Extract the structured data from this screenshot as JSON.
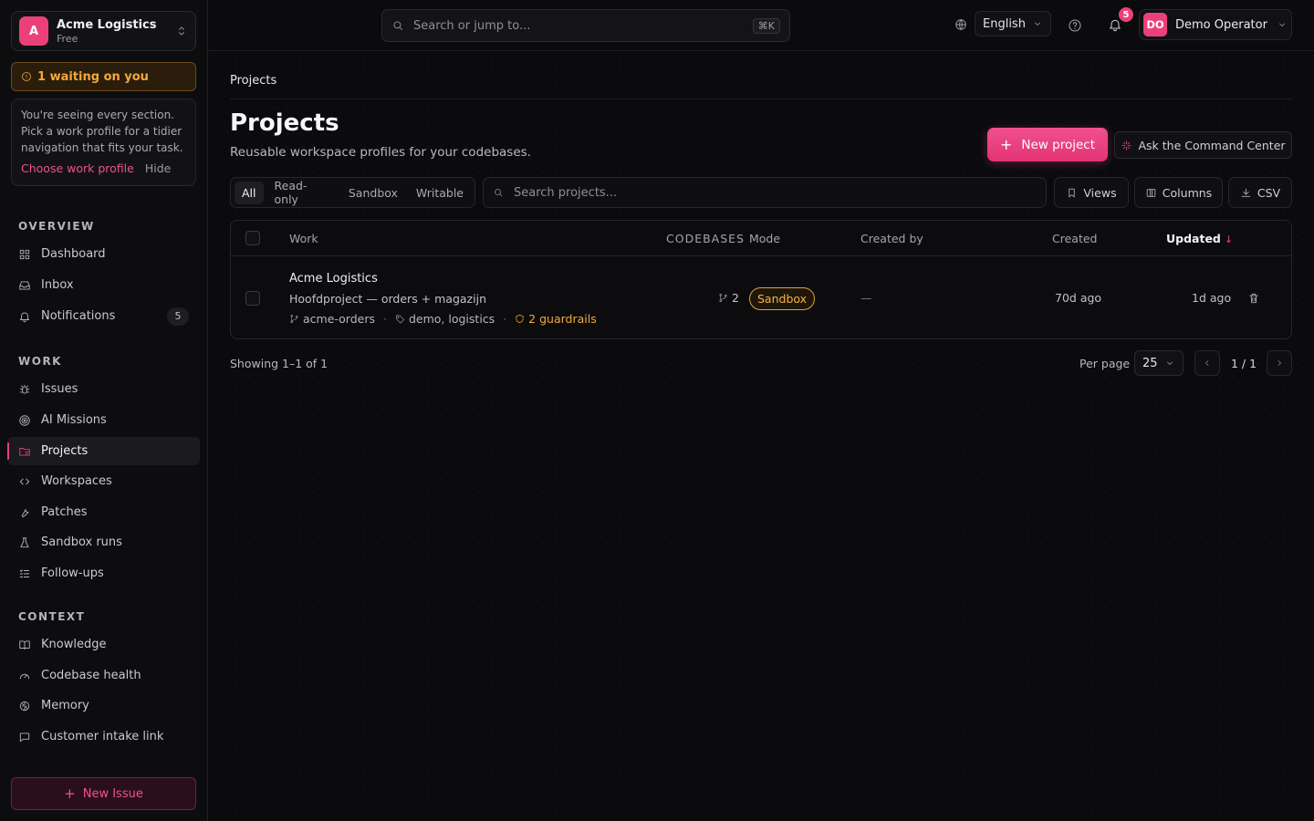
{
  "org": {
    "initial": "A",
    "name": "Acme Logistics",
    "plan": "Free"
  },
  "waiting": {
    "label": "1 waiting on you"
  },
  "profile_card": {
    "text": "You're seeing every section. Pick a work profile for a tidier navigation that fits your task.",
    "choose_label": "Choose work profile",
    "hide_label": "Hide"
  },
  "sidebar": {
    "overview_title": "OVERVIEW",
    "overview": [
      {
        "label": "Dashboard",
        "icon": "grid-icon"
      },
      {
        "label": "Inbox",
        "icon": "inbox-icon"
      },
      {
        "label": "Notifications",
        "icon": "bell-icon",
        "badge": "5"
      }
    ],
    "work_title": "WORK",
    "work": [
      {
        "label": "Issues",
        "icon": "bug-icon"
      },
      {
        "label": "AI Missions",
        "icon": "target-icon"
      },
      {
        "label": "Projects",
        "icon": "folder-icon",
        "active": true
      },
      {
        "label": "Workspaces",
        "icon": "code-icon"
      },
      {
        "label": "Patches",
        "icon": "wrench-icon"
      },
      {
        "label": "Sandbox runs",
        "icon": "flask-icon"
      },
      {
        "label": "Follow-ups",
        "icon": "list-check-icon"
      }
    ],
    "context_title": "CONTEXT",
    "context": [
      {
        "label": "Knowledge",
        "icon": "book-icon"
      },
      {
        "label": "Codebase health",
        "icon": "gauge-icon"
      },
      {
        "label": "Memory",
        "icon": "brain-icon"
      },
      {
        "label": "Customer intake link",
        "icon": "message-icon"
      }
    ],
    "new_issue_label": "New Issue"
  },
  "topbar": {
    "search_placeholder": "Search or jump to...",
    "search_shortcut": "⌘K",
    "language": "English",
    "notification_count": "5",
    "user_initials": "DO",
    "user_name": "Demo Operator"
  },
  "main": {
    "breadcrumb": "Projects",
    "title": "Projects",
    "subtitle": "Reusable workspace profiles for your codebases.",
    "new_project_label": "New project",
    "ask_label": "Ask the Command Center",
    "filter_tabs": [
      "All",
      "Read-only",
      "Sandbox",
      "Writable"
    ],
    "active_filter": "All",
    "table_search_placeholder": "Search projects...",
    "views_label": "Views",
    "columns_label": "Columns",
    "csv_label": "CSV",
    "columns": {
      "work": "Work",
      "codebases": "CODEBASES",
      "mode": "Mode",
      "created_by": "Created by",
      "created": "Created",
      "updated": "Updated",
      "sort_arrow": "↓"
    },
    "rows": [
      {
        "name": "Acme Logistics",
        "description": "Hoofdproject — orders + magazijn",
        "repo": "acme-orders",
        "tags": "demo, logistics",
        "guardrails": "2 guardrails",
        "codebases": "2",
        "mode": "Sandbox",
        "created_by": "—",
        "created": "70d ago",
        "updated": "1d ago"
      }
    ],
    "showing": "Showing 1–1 of 1",
    "per_page_label": "Per page",
    "per_page_value": "25",
    "page_indicator": "1 / 1"
  },
  "colors": {
    "accent": "#ec407a",
    "warning": "#f3a93b",
    "background": "#0b0b0d"
  }
}
